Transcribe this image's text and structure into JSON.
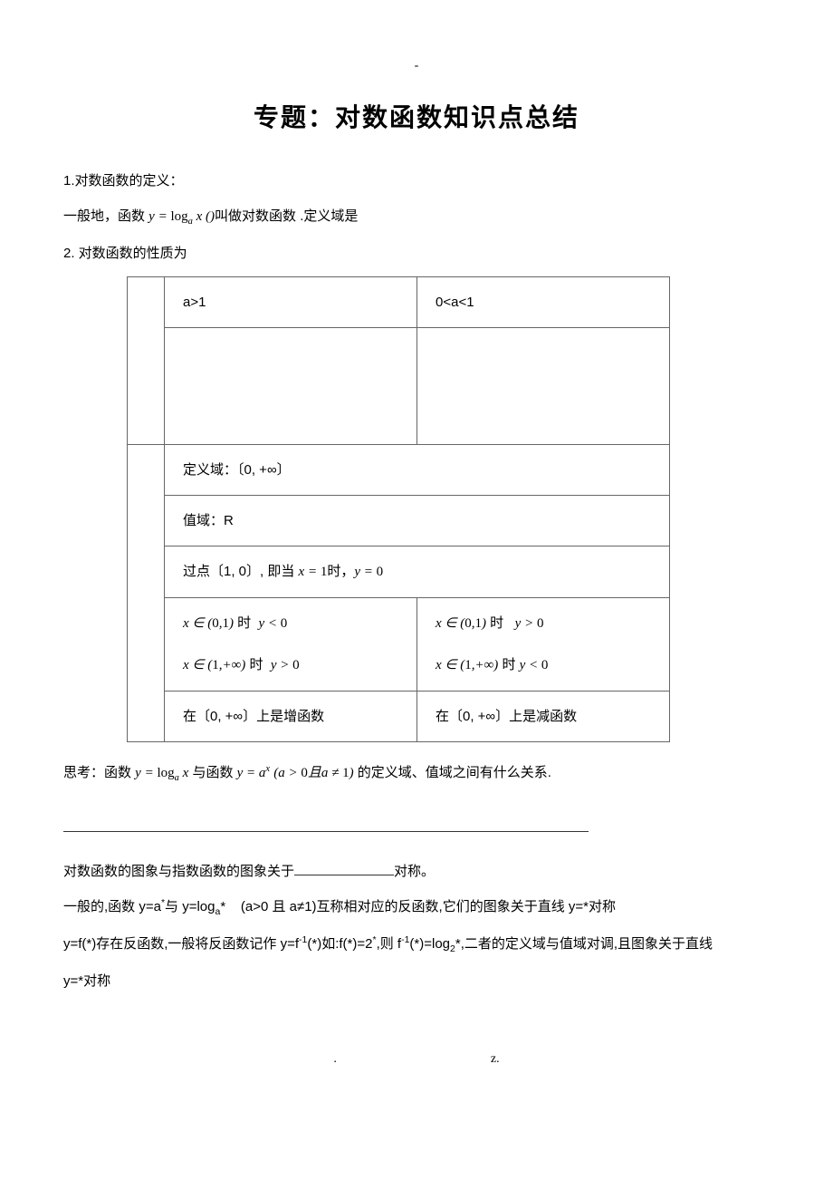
{
  "header_dash": "-",
  "title": "专题：对数函数知识点总结",
  "section1": {
    "heading": "1.对数函数的定义：",
    "definition": "一般地，函数 y = logₐ x ()叫做对数函数 .定义域是"
  },
  "section2": {
    "heading": "2. 对数函数的性质为",
    "table": {
      "row1": {
        "left": "a>1",
        "right": "0<a<1"
      },
      "row3": "定义域：〔0, +∞〕",
      "row4": "值域：R",
      "row5": "过点〔1, 0〕, 即当 x = 1 时，y = 0",
      "row6": {
        "left1": "x ∈ (0,1) 时  y < 0",
        "left2": "x ∈ (1,+∞) 时  y > 0",
        "right1": "x ∈ (0,1) 时   y > 0",
        "right2": "x ∈ (1,+∞) 时 y < 0"
      },
      "row7": {
        "left": "在〔0, +∞〕上是增函数",
        "right": "在〔0, +∞〕上是减函数"
      }
    }
  },
  "thinking": "思考：函数 y = logₐ x 与函数 y = aˣ (a > 0 且 a ≠ 1) 的定义域、值域之间有什么关系.",
  "symmetry_line_prefix": "对数函数的图象与指数函数的图象关于",
  "symmetry_line_suffix": "对称。",
  "inverse1": "一般的,函数 y=aˣ与 y=logₐ*    (a>0 且 a≠1)互称相对应的反函数,它们的图象关于直线 y=*对称",
  "inverse2": "y=f(*)存在反函数,一般将反函数记作 y=f⁻¹(*)如:f(*)=2ˣ,则 f⁻¹(*)=log₂*,二者的定义域与值域对调,且图象关于直线",
  "inverse3": "y=*对称",
  "footer_left": ".",
  "footer_right": "z."
}
